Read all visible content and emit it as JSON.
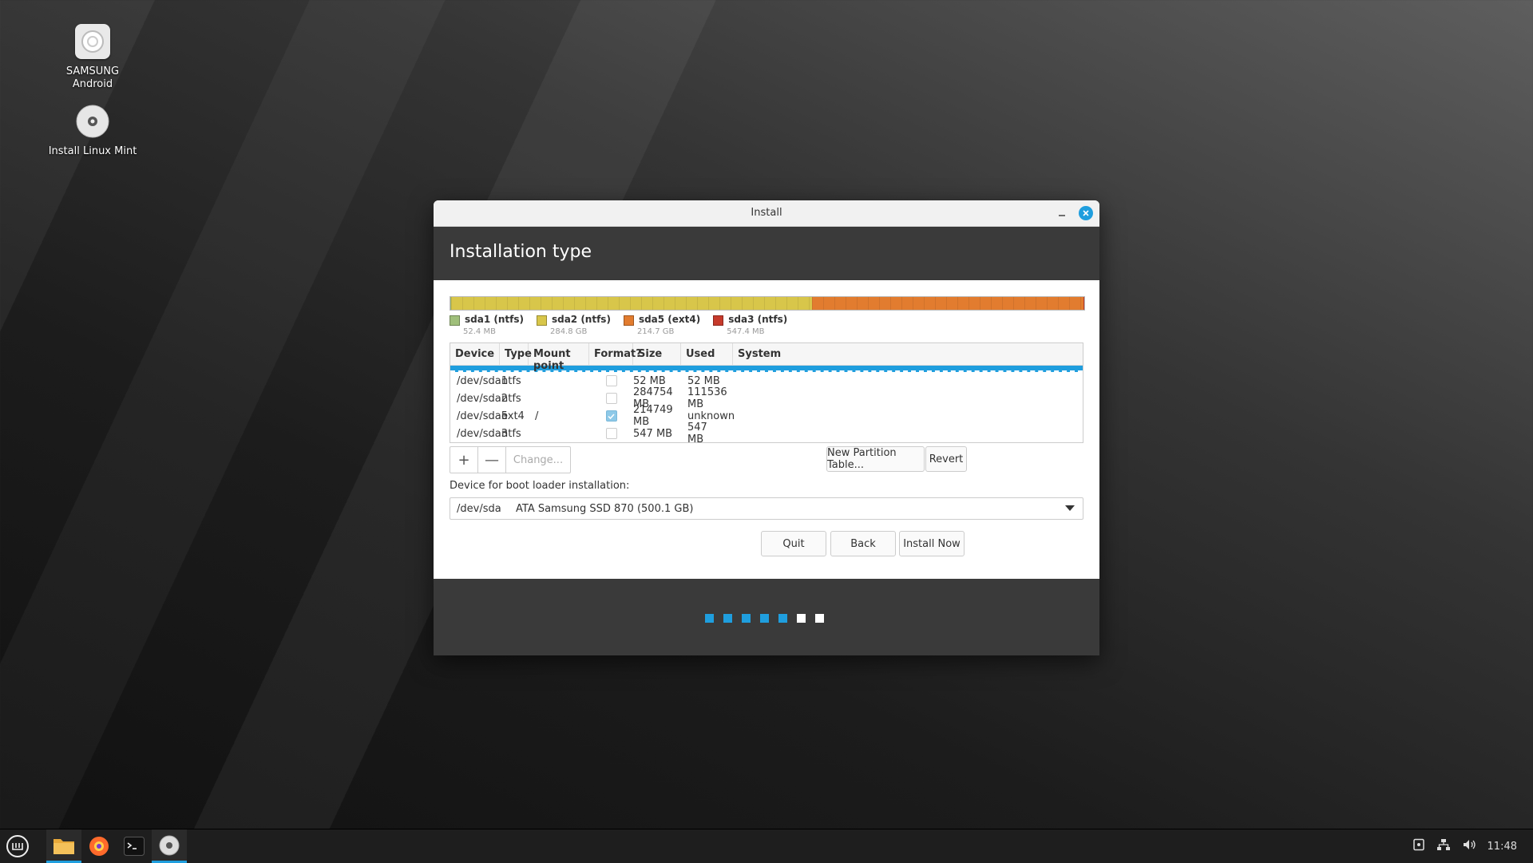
{
  "desktop": {
    "icons": [
      {
        "label_line1": "SAMSUNG",
        "label_line2": "Android",
        "icon": "device-icon"
      },
      {
        "label": "Install Linux Mint",
        "icon": "disc-icon"
      }
    ]
  },
  "window": {
    "title": "Install",
    "header_title": "Installation type"
  },
  "partitions": {
    "bar_segments": [
      {
        "name": "sda1 (ntfs)",
        "size": "52.4 MB",
        "color": "#9fbf7a",
        "fraction": 0.0001
      },
      {
        "name": "sda2 (ntfs)",
        "size": "284.8 GB",
        "color": "#d8c64a",
        "fraction": 0.569
      },
      {
        "name": "sda5 (ext4)",
        "size": "214.7 GB",
        "color": "#e27c2f",
        "fraction": 0.429
      },
      {
        "name": "sda3 (ntfs)",
        "size": "547.4 MB",
        "color": "#c63a2b",
        "fraction": 0.0011
      }
    ],
    "columns": [
      "Device",
      "Type",
      "Mount point",
      "Format?",
      "Size",
      "Used",
      "System"
    ],
    "rows": [
      {
        "device": "/dev/sda1",
        "type": "ntfs",
        "mount": "",
        "format": false,
        "size": "52 MB",
        "used": "52 MB",
        "system": ""
      },
      {
        "device": "/dev/sda2",
        "type": "ntfs",
        "mount": "",
        "format": false,
        "size": "284754 MB",
        "used": "111536 MB",
        "system": ""
      },
      {
        "device": "/dev/sda5",
        "type": "ext4",
        "mount": "/",
        "format": true,
        "size": "214749 MB",
        "used": "unknown",
        "system": ""
      },
      {
        "device": "/dev/sda3",
        "type": "ntfs",
        "mount": "",
        "format": false,
        "size": "547 MB",
        "used": "547 MB",
        "system": ""
      }
    ]
  },
  "toolbar": {
    "add_label": "+",
    "remove_label": "—",
    "change_label": "Change...",
    "new_table_label": "New Partition Table...",
    "revert_label": "Revert"
  },
  "boot": {
    "label": "Device for boot loader installation:",
    "device": "/dev/sda",
    "description": "ATA Samsung SSD 870 (500.1 GB)"
  },
  "actions": {
    "quit": "Quit",
    "back": "Back",
    "install_now": "Install Now"
  },
  "progress": {
    "total_steps": 7,
    "completed_steps": 5,
    "active_color": "#1f9ede",
    "inactive_color": "#ffffff"
  },
  "taskbar": {
    "apps": [
      "menu-icon",
      "files-icon",
      "firefox-icon",
      "terminal-icon",
      "installer-icon"
    ],
    "clock": "11:48"
  }
}
